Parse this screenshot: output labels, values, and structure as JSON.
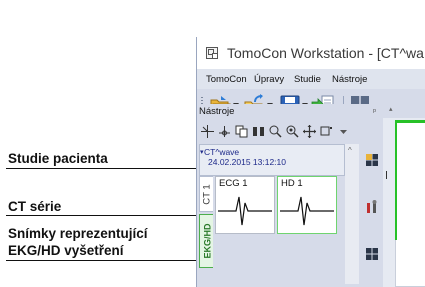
{
  "annotations": [
    {
      "label": "Studie pacienta"
    },
    {
      "label": "CT série"
    },
    {
      "label": "Snímky reprezentující"
    },
    {
      "label": "EKG/HD vyšetření"
    }
  ],
  "window": {
    "title": "TomoCon Workstation - [CT^wa"
  },
  "menu": {
    "items": [
      "TomoCon",
      "Úpravy",
      "Studie",
      "Nástroje"
    ]
  },
  "panel": {
    "title": "Nástroje",
    "pin": "ᵖ"
  },
  "study": {
    "name": "CT^wave",
    "date": "24.02.2015 13:12:10"
  },
  "tabs": {
    "ct": "CT 1",
    "ekg": "EKG/HD"
  },
  "thumbnails": [
    {
      "label": "ECG 1"
    },
    {
      "label": "HD 1"
    }
  ],
  "colors": {
    "accent_green": "#27c127",
    "ekg_tab_green": "#2a7a2a",
    "study_text": "#1e2a8a"
  }
}
